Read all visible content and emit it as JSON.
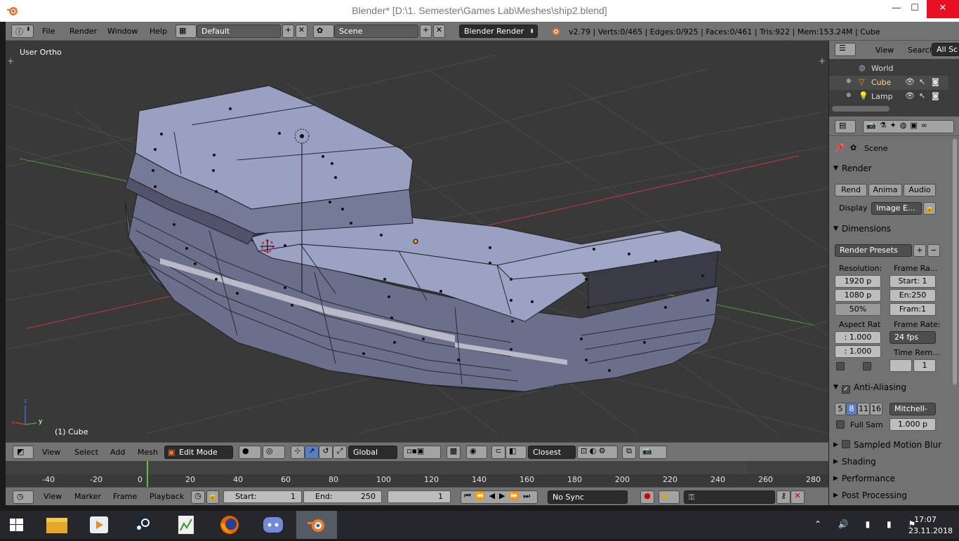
{
  "window": {
    "title": "Blender* [D:\\1. Semester\\Games Lab\\Meshes\\ship2.blend]",
    "minimize": "—",
    "maximize": "☐",
    "close": "✕"
  },
  "info_header": {
    "menus": [
      "File",
      "Render",
      "Window",
      "Help"
    ],
    "layout": "Default",
    "scene": "Scene",
    "engine": "Blender Render",
    "stats": "v2.79 | Verts:0/465 | Edges:0/925 | Faces:0/461 | Tris:922 | Mem:153.24M | Cube"
  },
  "viewport": {
    "view_label": "User Ortho",
    "object_label": "(1) Cube",
    "axis_x": "x",
    "axis_y": "y",
    "axis_z": "z"
  },
  "view3d_header": {
    "menus": [
      "View",
      "Select",
      "Add",
      "Mesh"
    ],
    "mode": "Edit Mode",
    "orientation": "Global",
    "snap": "Closest"
  },
  "timeline": {
    "ticks": [
      "-40",
      "-20",
      "0",
      "20",
      "40",
      "60",
      "80",
      "100",
      "120",
      "140",
      "160",
      "180",
      "200",
      "220",
      "240",
      "260",
      "280"
    ],
    "current_frame_value": 1,
    "menus": [
      "View",
      "Marker",
      "Frame",
      "Playback"
    ],
    "start_label": "Start:",
    "start_value": "1",
    "end_label": "End:",
    "end_value": "250",
    "current_value": "1",
    "sync": "No Sync"
  },
  "outliner": {
    "menus": [
      "View",
      "Search"
    ],
    "filter": "All Sc",
    "items": [
      {
        "label": "World",
        "icon": "world-icon"
      },
      {
        "label": "Cube",
        "icon": "mesh-icon"
      },
      {
        "label": "Lamp",
        "icon": "lamp-icon"
      }
    ]
  },
  "properties": {
    "context": "Scene",
    "render_panel": {
      "title": "Render",
      "buttons": [
        "Rend",
        "Anima",
        "Audio"
      ],
      "display_label": "Display",
      "display_value": "Image E..."
    },
    "dimensions_panel": {
      "title": "Dimensions",
      "presets": "Render Presets",
      "resolution_label": "Resolution:",
      "res_x": "1920 p",
      "res_y": "1080 p",
      "res_pct": "50%",
      "frame_range_label": "Frame Ra...",
      "start": "Start: 1",
      "end": "En:250",
      "step": "Fram:1",
      "aspect_label": "Aspect Rat",
      "aspect_x": ": 1.000",
      "aspect_y": ": 1.000",
      "frame_rate_label": "Frame Rate:",
      "fps": "24 fps",
      "time_remap_label": "Time Rem...",
      "time_remap_value": "1"
    },
    "aa_panel": {
      "title": "Anti-Aliasing",
      "samples": [
        "5",
        "8",
        "11",
        "16"
      ],
      "selected_sample": "8",
      "filter": "Mitchell-",
      "full_sample": "Full Sam",
      "filter_size": "1.000 p"
    },
    "collapsed_panels": [
      "Sampled Motion Blur",
      "Shading",
      "Performance",
      "Post Processing"
    ]
  },
  "taskbar": {
    "time": "17:07",
    "date": "23.11.2018"
  },
  "colors": {
    "viewport_bg": "#393939",
    "header_bg": "#727272",
    "mesh_face": "#8d93b3",
    "x_axis": "#c8383a",
    "y_axis": "#4e9a3a",
    "accent": "#5680c2"
  }
}
